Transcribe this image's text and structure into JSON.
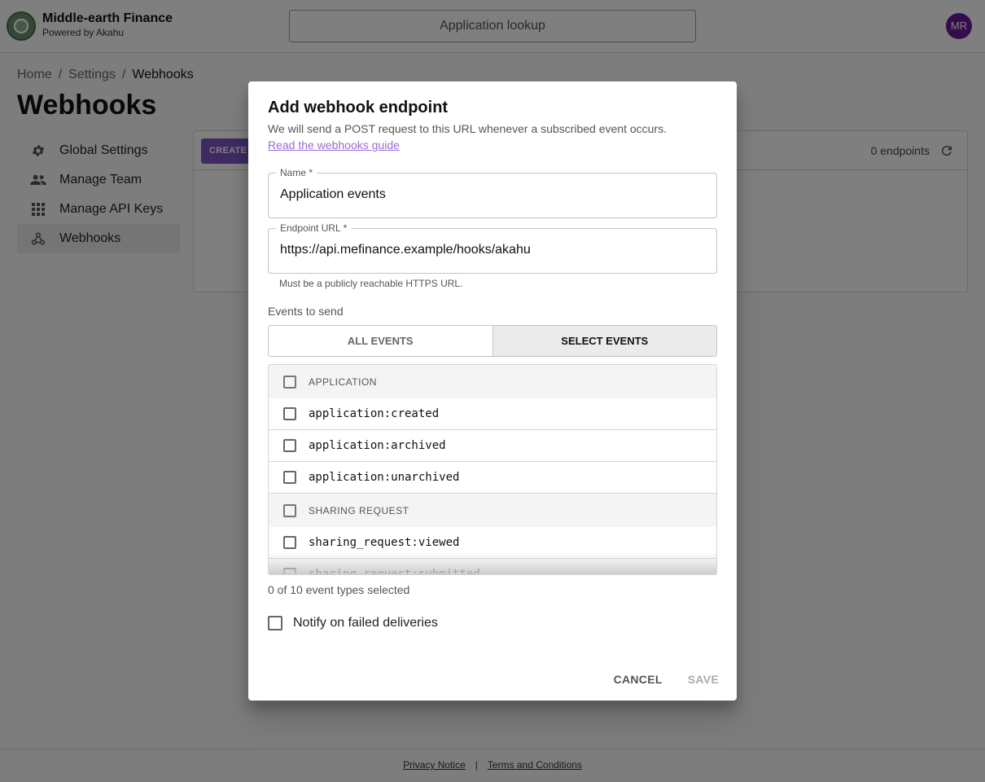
{
  "brand": {
    "name": "Middle-earth Finance",
    "subtitle": "Powered by Akahu"
  },
  "search": {
    "label": "Application lookup"
  },
  "user": {
    "initials": "MR"
  },
  "breadcrumb": {
    "home": "Home",
    "settings": "Settings",
    "current": "Webhooks",
    "separator": "/"
  },
  "page": {
    "title": "Webhooks"
  },
  "sidebar": {
    "items": [
      {
        "label": "Global Settings",
        "icon": "gear-icon"
      },
      {
        "label": "Manage Team",
        "icon": "people-icon"
      },
      {
        "label": "Manage API Keys",
        "icon": "grid-icon"
      },
      {
        "label": "Webhooks",
        "icon": "webhook-icon",
        "active": true
      }
    ]
  },
  "panel": {
    "create_label": "CREATE",
    "endpoint_count": "0 endpoints"
  },
  "footer": {
    "privacy": "Privacy Notice",
    "separator": "|",
    "terms": "Terms and Conditions"
  },
  "dialog": {
    "title": "Add webhook endpoint",
    "description": "We will send a POST request to this URL whenever a subscribed event occurs.",
    "guide_link": "Read the webhooks guide",
    "name_field": {
      "label": "Name *",
      "value": "Application events"
    },
    "url_field": {
      "label": "Endpoint URL *",
      "value": "https://api.mefinance.example/hooks/akahu",
      "helper": "Must be a publicly reachable HTTPS URL."
    },
    "events_label": "Events to send",
    "toggle": {
      "all": "ALL EVENTS",
      "select": "SELECT EVENTS",
      "selected": "select"
    },
    "groups": [
      {
        "label": "APPLICATION",
        "events": [
          "application:created",
          "application:archived",
          "application:unarchived"
        ]
      },
      {
        "label": "SHARING REQUEST",
        "events": [
          "sharing_request:viewed",
          "sharing_request:submitted"
        ]
      }
    ],
    "selected_count": "0 of 10 event types selected",
    "notify_label": "Notify on failed deliveries",
    "cancel_label": "CANCEL",
    "save_label": "SAVE"
  },
  "colors": {
    "accent": "#7e57c2",
    "avatar": "#6a1b9a",
    "link": "#9c6ad6"
  }
}
